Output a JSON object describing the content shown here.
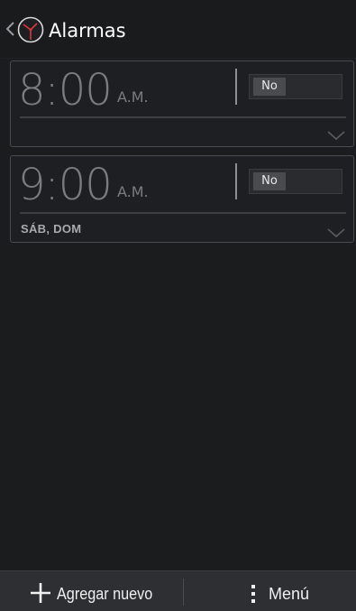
{
  "header": {
    "title": "Alarmas",
    "back_icon": "chevron-left-icon",
    "logo_icon": "clock-icon"
  },
  "alarms": [
    {
      "time": "8:00",
      "period": "A.M.",
      "toggle_label": "No",
      "days": ""
    },
    {
      "time": "9:00",
      "period": "A.M.",
      "toggle_label": "No",
      "days": "SÁB, DOM"
    }
  ],
  "bottom_bar": {
    "add_label": "Agregar nuevo",
    "add_icon": "plus-icon",
    "menu_label": "Menú",
    "menu_icon": "overflow-dots-icon"
  },
  "colors": {
    "background": "#1b1c1e",
    "card_border": "#4a4b4e",
    "time_text": "#7b7c80",
    "bottom_bar": "#2e2f32",
    "clock_hands": "#e0353a"
  }
}
